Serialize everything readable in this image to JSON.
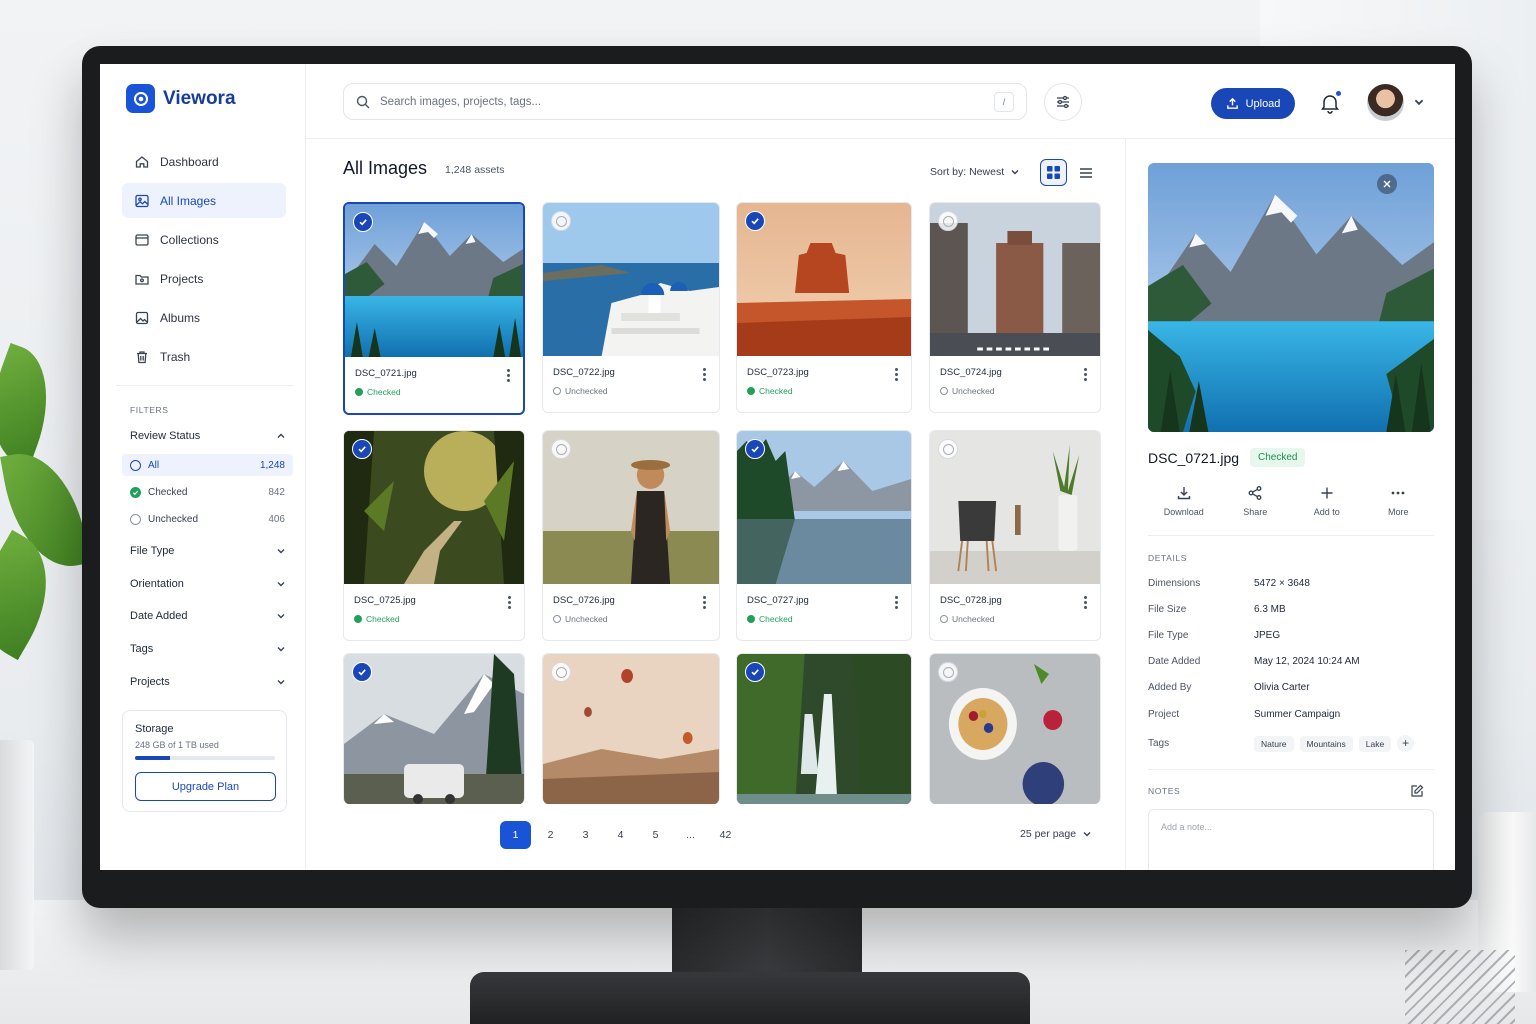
{
  "app": {
    "name": "Viewora"
  },
  "sidebar": {
    "nav": [
      {
        "label": "Dashboard",
        "icon": "home-icon",
        "active": false
      },
      {
        "label": "All Images",
        "icon": "image-icon",
        "active": true
      },
      {
        "label": "Collections",
        "icon": "folder-icon",
        "active": false
      },
      {
        "label": "Projects",
        "icon": "project-icon",
        "active": false
      },
      {
        "label": "Albums",
        "icon": "album-icon",
        "active": false
      },
      {
        "label": "Trash",
        "icon": "trash-icon",
        "active": false
      }
    ],
    "filters_label": "FILTERS",
    "review_status": {
      "label": "Review Status",
      "options": [
        {
          "label": "All",
          "count": "1,248"
        },
        {
          "label": "Checked",
          "count": "842"
        },
        {
          "label": "Unchecked",
          "count": "406"
        }
      ]
    },
    "filter_groups": [
      "File Type",
      "Orientation",
      "Date Added",
      "Tags",
      "Projects"
    ],
    "storage": {
      "title": "Storage",
      "used": "248 GB of 1 TB used",
      "used_fraction": 0.248,
      "upgrade_label": "Upgrade Plan"
    }
  },
  "topbar": {
    "search_placeholder": "Search images, projects, tags...",
    "search_shortcut": "/",
    "upload_label": "Upload"
  },
  "content": {
    "title": "All Images",
    "count": "1,248 assets",
    "sort_label": "Sort by: Newest",
    "images": [
      {
        "file": "DSC_0721.jpg",
        "status": "Checked",
        "selected": true,
        "scene": "lake"
      },
      {
        "file": "DSC_0722.jpg",
        "status": "Unchecked",
        "selected": false,
        "scene": "santorini"
      },
      {
        "file": "DSC_0723.jpg",
        "status": "Checked",
        "selected": false,
        "scene": "desert"
      },
      {
        "file": "DSC_0724.jpg",
        "status": "Unchecked",
        "selected": false,
        "scene": "city"
      },
      {
        "file": "DSC_0725.jpg",
        "status": "Checked",
        "selected": false,
        "scene": "forest"
      },
      {
        "file": "DSC_0726.jpg",
        "status": "Unchecked",
        "selected": false,
        "scene": "woman"
      },
      {
        "file": "DSC_0727.jpg",
        "status": "Checked",
        "selected": false,
        "scene": "lake2"
      },
      {
        "file": "DSC_0728.jpg",
        "status": "Unchecked",
        "selected": false,
        "scene": "chair"
      },
      {
        "file": "",
        "status": "Checked",
        "selected": false,
        "scene": "van"
      },
      {
        "file": "",
        "status": "Unchecked",
        "selected": false,
        "scene": "balloons"
      },
      {
        "file": "",
        "status": "Checked",
        "selected": false,
        "scene": "waterfall"
      },
      {
        "file": "",
        "status": "Unchecked",
        "selected": false,
        "scene": "food"
      }
    ],
    "pagination": {
      "pages": [
        "1",
        "2",
        "3",
        "4",
        "5",
        "...",
        "42"
      ],
      "current": "1",
      "per_page": "25 per page"
    }
  },
  "detail": {
    "file": "DSC_0721.jpg",
    "status": "Checked",
    "actions": [
      {
        "label": "Download",
        "icon": "download-icon"
      },
      {
        "label": "Share",
        "icon": "share-icon"
      },
      {
        "label": "Add to",
        "icon": "plus-icon"
      },
      {
        "label": "More",
        "icon": "more-icon"
      }
    ],
    "details_label": "DETAILS",
    "fields": [
      {
        "key": "Dimensions",
        "value": "5472 × 3648"
      },
      {
        "key": "File Size",
        "value": "6.3 MB"
      },
      {
        "key": "File Type",
        "value": "JPEG"
      },
      {
        "key": "Date Added",
        "value": "May 12, 2024 10:24 AM"
      },
      {
        "key": "Added By",
        "value": "Olivia Carter"
      },
      {
        "key": "Project",
        "value": "Summer Campaign"
      }
    ],
    "tags_label": "Tags",
    "tags": [
      "Nature",
      "Mountains",
      "Lake"
    ],
    "notes_label": "NOTES",
    "notes_placeholder": "Add a note..."
  },
  "colors": {
    "accent": "#1a47b8",
    "checked": "#22a05b"
  }
}
